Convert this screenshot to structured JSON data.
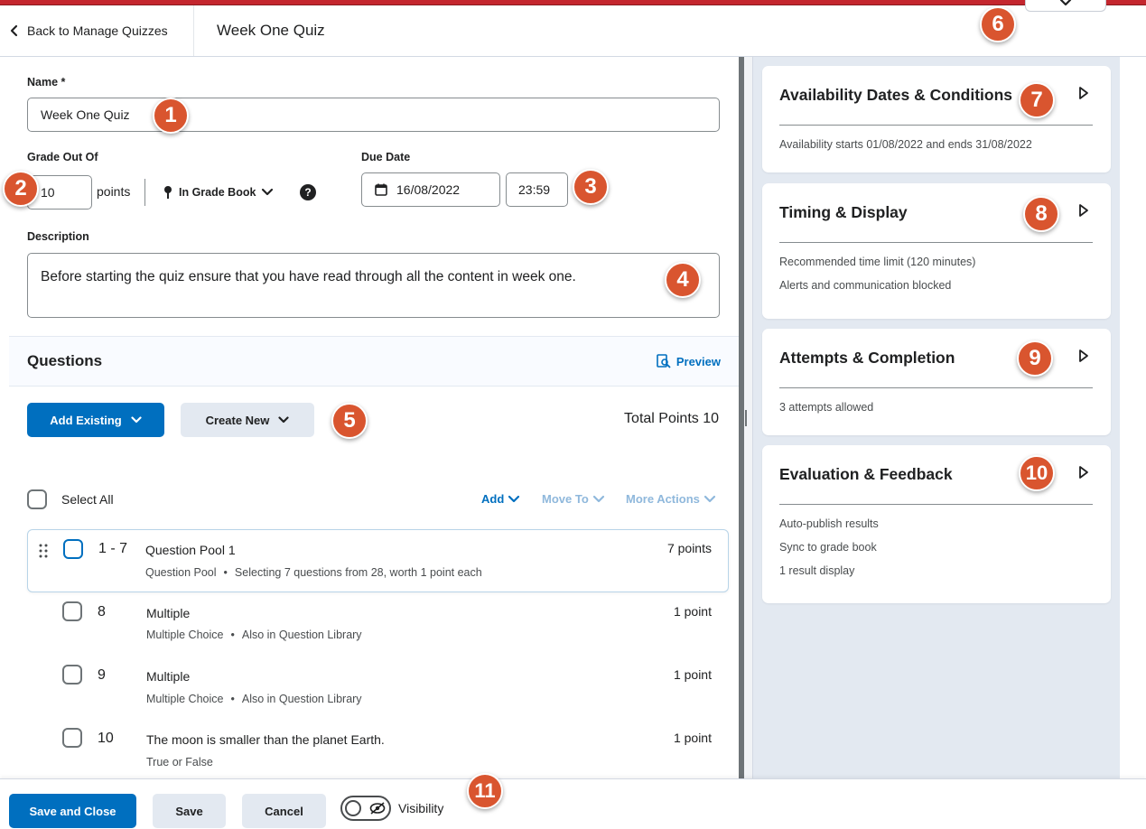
{
  "header": {
    "back_label": "Back to Manage Quizzes",
    "title": "Week One Quiz"
  },
  "form": {
    "name_label": "Name *",
    "name_value": "Week One Quiz",
    "grade_label": "Grade Out Of",
    "grade_value": "10",
    "points_label": "points",
    "gradebook_label": "In Grade Book",
    "due_label": "Due Date",
    "due_date": "16/08/2022",
    "due_time": "23:59",
    "description_label": "Description",
    "description_value": "Before starting the quiz ensure that you have read through all the content in week one."
  },
  "questions": {
    "title": "Questions",
    "preview_label": "Preview",
    "add_existing": "Add Existing",
    "create_new": "Create New",
    "total_points": "Total Points 10",
    "select_all": "Select All",
    "bulk_add": "Add",
    "bulk_move": "Move To",
    "bulk_more": "More Actions",
    "pool": {
      "num": "1 - 7",
      "name": "Question Pool 1",
      "type": "Question Pool",
      "detail": "Selecting 7 questions from 28, worth 1 point each",
      "points": "7 points"
    },
    "items": [
      {
        "num": "8",
        "name": "Multiple",
        "type": "Multiple Choice",
        "detail": "Also in Question Library",
        "points": "1 point"
      },
      {
        "num": "9",
        "name": "Multiple",
        "type": "Multiple Choice",
        "detail": "Also in Question Library",
        "points": "1 point"
      },
      {
        "num": "10",
        "name": "The moon is smaller than the planet Earth.",
        "type": "True or False",
        "detail": "",
        "points": "1 point"
      }
    ]
  },
  "sidebar": {
    "cards": [
      {
        "title": "Availability Dates & Conditions",
        "lines": [
          "Availability starts 01/08/2022 and ends 31/08/2022"
        ]
      },
      {
        "title": "Timing & Display",
        "lines": [
          "Recommended time limit (120 minutes)",
          "Alerts and communication blocked"
        ]
      },
      {
        "title": "Attempts & Completion",
        "lines": [
          "3 attempts allowed"
        ]
      },
      {
        "title": "Evaluation & Feedback",
        "lines": [
          "Auto-publish results",
          "Sync to grade book",
          "1 result display"
        ]
      }
    ]
  },
  "footer": {
    "save_close": "Save and Close",
    "save": "Save",
    "cancel": "Cancel",
    "visibility": "Visibility"
  },
  "badges": [
    "1",
    "2",
    "3",
    "4",
    "5",
    "6",
    "7",
    "8",
    "9",
    "10",
    "11"
  ],
  "colors": {
    "brand_bar": "#c4262e",
    "primary": "#006fbf",
    "badge": "#d9552f",
    "sidebar_bg": "#e3e9f1"
  }
}
